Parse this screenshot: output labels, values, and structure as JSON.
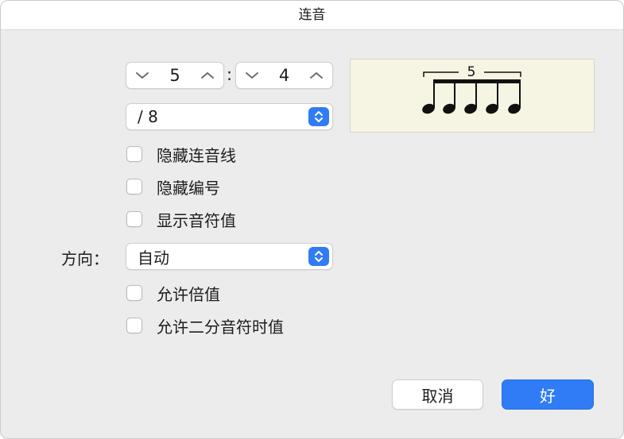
{
  "window": {
    "title": "连音"
  },
  "ratio": {
    "numerator": "5",
    "colon": ":",
    "denominator": "4"
  },
  "unit_popup": {
    "value": "/ 8"
  },
  "checkboxes": {
    "hide_bracket": {
      "label": "隐藏连音线",
      "checked": false
    },
    "hide_number": {
      "label": "隐藏编号",
      "checked": false
    },
    "show_note_value": {
      "label": "显示音符值",
      "checked": false
    },
    "allow_multiple": {
      "label": "允许倍值",
      "checked": false
    },
    "allow_half_note": {
      "label": "允许二分音符时值",
      "checked": false
    }
  },
  "direction": {
    "label": "方向：",
    "value": "自动"
  },
  "preview": {
    "tuplet_number": "5"
  },
  "buttons": {
    "cancel": "取消",
    "ok": "好"
  },
  "colors": {
    "accent": "#2f7cf6",
    "preview_bg": "#f6f4e3"
  },
  "icons": {
    "decrement": "chevron-down-icon",
    "increment": "chevron-up-icon",
    "popup": "up-down-arrows-icon"
  }
}
